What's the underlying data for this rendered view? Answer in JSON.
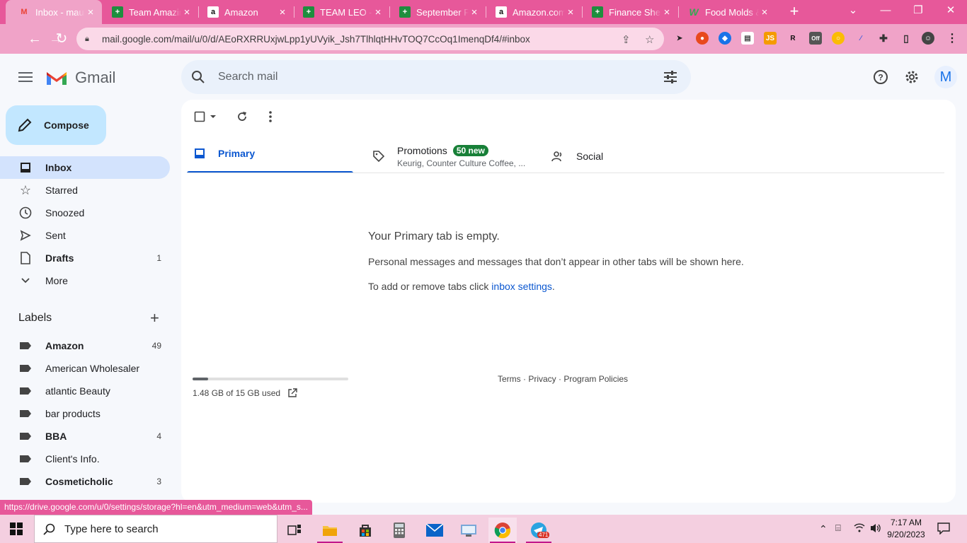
{
  "browser": {
    "tabs": [
      {
        "title": "Inbox - mauiCoral",
        "favicon": "gmail-favicon",
        "active": true
      },
      {
        "title": "Team Amazing Leo",
        "favicon": "sheets-favicon"
      },
      {
        "title": "Amazon",
        "favicon": "amazon-favicon"
      },
      {
        "title": "TEAM LEO - Google Sheets",
        "favicon": "sheets-favicon"
      },
      {
        "title": "September Products",
        "favicon": "sheets-favicon"
      },
      {
        "title": "Amazon.com",
        "favicon": "amazon-favicon"
      },
      {
        "title": "Finance Sheet",
        "favicon": "sheets-favicon"
      },
      {
        "title": "Food Molds & Trays",
        "favicon": "w-favicon"
      }
    ],
    "url": "mail.google.com/mail/u/0/d/AEoRXRRUxjwLpp1yUVyik_Jsh7TlhlqtHHvTOQ7CcOq1ImenqDf4/#inbox",
    "ext_js_label": "JS",
    "ext_off_label": "Off",
    "status_url": "https://drive.google.com/u/0/settings/storage?hl=en&utm_medium=web&utm_s..."
  },
  "gmail": {
    "logo_text": "Gmail",
    "search_placeholder": "Search mail",
    "avatar_letter": "M",
    "compose_label": "Compose",
    "nav": [
      {
        "label": "Inbox",
        "count": ""
      },
      {
        "label": "Starred",
        "count": ""
      },
      {
        "label": "Snoozed",
        "count": ""
      },
      {
        "label": "Sent",
        "count": ""
      },
      {
        "label": "Drafts",
        "count": "1"
      },
      {
        "label": "More",
        "count": ""
      }
    ],
    "labels_heading": "Labels",
    "labels": [
      {
        "label": "Amazon",
        "count": "49"
      },
      {
        "label": "American Wholesaler",
        "count": ""
      },
      {
        "label": "atlantic Beauty",
        "count": ""
      },
      {
        "label": "bar products",
        "count": ""
      },
      {
        "label": "BBA",
        "count": "4"
      },
      {
        "label": "Client's Info.",
        "count": ""
      },
      {
        "label": "Cosmeticholic",
        "count": "3"
      }
    ],
    "tabs": {
      "primary": "Primary",
      "promotions": "Promotions",
      "promotions_badge": "50 new",
      "promotions_snippet": "Keurig, Counter Culture Coffee, ...",
      "social": "Social"
    },
    "empty": {
      "title": "Your Primary tab is empty.",
      "line1": "Personal messages and messages that don’t appear in other tabs will be shown here.",
      "line2_prefix": "To add or remove tabs click ",
      "line2_link": "inbox settings",
      "line2_suffix": "."
    },
    "storage": {
      "text": "1.48 GB of 15 GB used",
      "fraction": 0.0987
    },
    "footer": {
      "terms": "Terms",
      "privacy": "Privacy",
      "policies": "Program Policies",
      "sep": " · "
    }
  },
  "taskbar": {
    "search_placeholder": "Type here to search",
    "time": "7:17 AM",
    "date": "9/20/2023",
    "telegram_badge": "471"
  },
  "colors": {
    "browser_frame": "#e7589a",
    "toolbar": "#f0a3c8",
    "accent": "#0b57d0",
    "badge": "#188038"
  }
}
